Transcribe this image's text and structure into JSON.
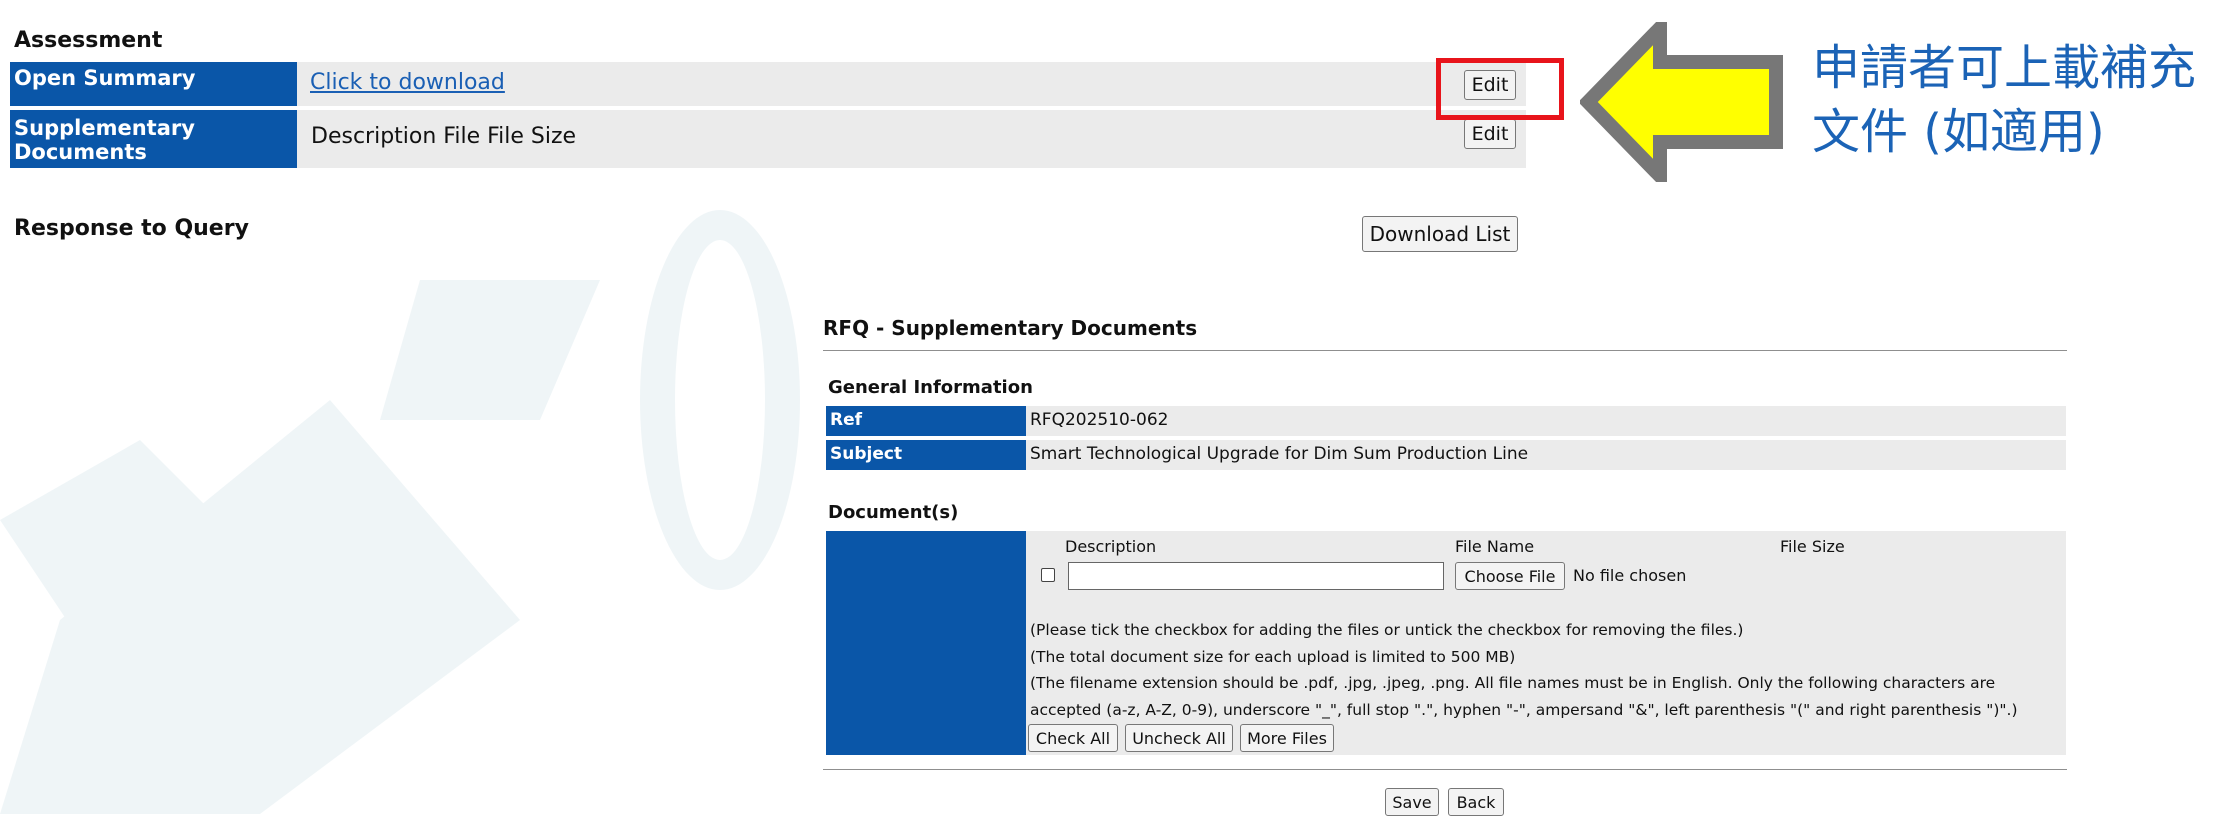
{
  "assessment": {
    "title": "Assessment",
    "rows": [
      {
        "label": "Open Summary",
        "value": "Click to download",
        "button": "Edit"
      },
      {
        "label": "Supplementary Documents",
        "value": "Description File File Size",
        "button": "Edit"
      }
    ],
    "response_title": "Response to Query",
    "download_list_label": "Download List"
  },
  "callout": {
    "line1": "申請者可上載補充",
    "line2": "文件 (如適用)",
    "arrow_fill": "#ffff00",
    "arrow_border": "#777777",
    "highlight_color": "#e8141b"
  },
  "dialog": {
    "title": "RFQ - Supplementary Documents",
    "general_title": "General Information",
    "ref_label": "Ref",
    "ref_value": "RFQ202510-062",
    "subject_label": "Subject",
    "subject_value": "Smart Technological Upgrade for Dim Sum Production Line",
    "documents_title": "Document(s)",
    "col_description": "Description",
    "col_file_name": "File Name",
    "col_file_size": "File Size",
    "choose_file_label": "Choose File",
    "no_file_text": "No file chosen",
    "note1": "(Please tick the checkbox for adding the files or untick the checkbox for removing the files.)",
    "note2": "(The total document size for each upload is limited to 500 MB)",
    "note3": "(The filename extension should be .pdf, .jpg, .jpeg, .png. All file names must be in English. Only the following characters are",
    "note4": "accepted (a-z, A-Z, 0-9), underscore \"_\", full stop \".\", hyphen \"-\", ampersand \"&\", left parenthesis \"(\" and right parenthesis \")\".)",
    "check_all_label": "Check All",
    "uncheck_all_label": "Uncheck All",
    "more_files_label": "More Files",
    "save_label": "Save",
    "back_label": "Back"
  },
  "colors": {
    "label_blue": "#0a56a8",
    "row_gray": "#ebebeb",
    "link_blue": "#1a5fb4",
    "callout_blue": "#1b63b6"
  }
}
